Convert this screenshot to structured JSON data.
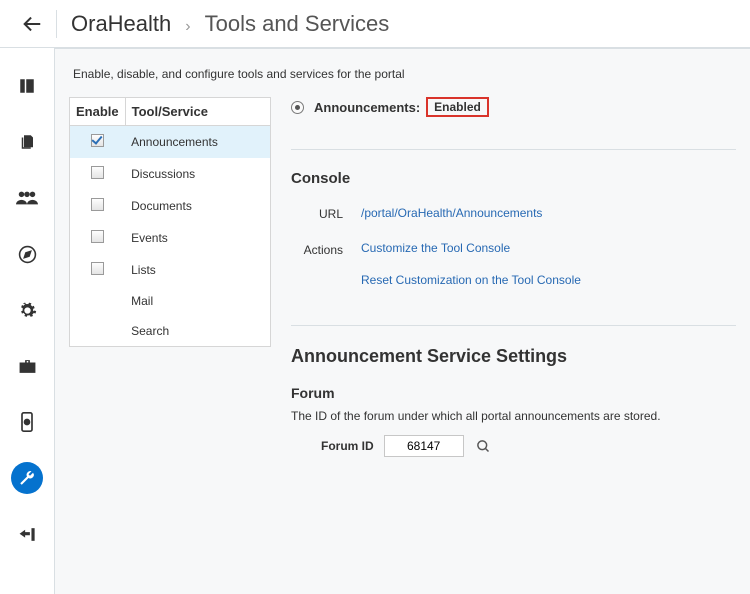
{
  "breadcrumb": {
    "root": "OraHealth",
    "leaf": "Tools and Services"
  },
  "intro": "Enable, disable, and configure tools and services for the portal",
  "table": {
    "col_enable": "Enable",
    "col_tool": "Tool/Service",
    "rows": [
      {
        "label": "Announcements",
        "checked": true,
        "selected": true,
        "hasCheckbox": true
      },
      {
        "label": "Discussions",
        "checked": false,
        "selected": false,
        "hasCheckbox": true
      },
      {
        "label": "Documents",
        "checked": false,
        "selected": false,
        "hasCheckbox": true
      },
      {
        "label": "Events",
        "checked": false,
        "selected": false,
        "hasCheckbox": true
      },
      {
        "label": "Lists",
        "checked": false,
        "selected": false,
        "hasCheckbox": true
      },
      {
        "label": "Mail",
        "checked": false,
        "selected": false,
        "hasCheckbox": false
      },
      {
        "label": "Search",
        "checked": false,
        "selected": false,
        "hasCheckbox": false
      }
    ]
  },
  "detail": {
    "radio_label": "Announcements:",
    "status": "Enabled",
    "console_heading": "Console",
    "url_label": "URL",
    "url_value": "/portal/OraHealth/Announcements",
    "actions_label": "Actions",
    "action_customize": "Customize the Tool Console",
    "action_reset": "Reset Customization on the Tool Console",
    "settings_heading": "Announcement Service Settings",
    "forum_heading": "Forum",
    "forum_helper": "The ID of the forum under which all portal announcements are stored.",
    "forum_id_label": "Forum ID",
    "forum_id_value": "68147"
  }
}
